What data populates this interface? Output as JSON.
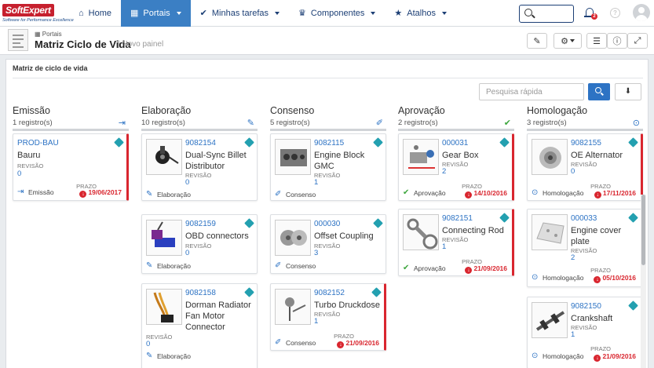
{
  "brand": {
    "logo_text": "SoftExpert",
    "tagline": "Software for Performance Excellence"
  },
  "nav": {
    "home": "Home",
    "portais": "Portais",
    "tarefas": "Minhas tarefas",
    "componentes": "Componentes",
    "atalhos": "Atalhos"
  },
  "notifications": {
    "badge": "2"
  },
  "header": {
    "breadcrumb": "Portais",
    "title": "Matriz Ciclo de Vida",
    "subtitle": "| Novo painel"
  },
  "panel": {
    "title": "Matriz de ciclo de vida",
    "quick_search_placeholder": "Pesquisa rápida"
  },
  "labels": {
    "revisao": "REVISÃO",
    "prazo": "PRAZO"
  },
  "columns": [
    {
      "name": "Emissão",
      "count": "1 registro(s)",
      "cards": [
        {
          "code": "PROD-BAU",
          "name": "Bauru",
          "rev": "0",
          "stage": "Emissão",
          "prazo": "19/06/2017"
        }
      ]
    },
    {
      "name": "Elaboração",
      "count": "10 registro(s)",
      "cards": [
        {
          "code": "9082154",
          "name": "Dual-Sync Billet Distributor",
          "rev": "0",
          "stage": "Elaboração"
        },
        {
          "code": "9082159",
          "name": "OBD connectors",
          "rev": "0",
          "stage": "Elaboração"
        },
        {
          "code": "9082158",
          "name": "Dorman Radiator Fan Motor Connector",
          "rev": "0",
          "stage": "Elaboração"
        }
      ]
    },
    {
      "name": "Consenso",
      "count": "5 registro(s)",
      "cards": [
        {
          "code": "9082115",
          "name": "Engine Block GMC",
          "rev": "1",
          "stage": "Consenso"
        },
        {
          "code": "000030",
          "name": "Offset Coupling",
          "rev": "3",
          "stage": "Consenso"
        },
        {
          "code": "9082152",
          "name": "Turbo Druckdose",
          "rev": "1",
          "stage": "Consenso",
          "prazo": "21/09/2016"
        }
      ]
    },
    {
      "name": "Aprovação",
      "count": "2 registro(s)",
      "cards": [
        {
          "code": "000031",
          "name": "Gear Box",
          "rev": "2",
          "stage": "Aprovação",
          "prazo": "14/10/2016"
        },
        {
          "code": "9082151",
          "name": "Connecting Rod",
          "rev": "1",
          "stage": "Aprovação",
          "prazo": "21/09/2016"
        }
      ]
    },
    {
      "name": "Homologação",
      "count": "3 registro(s)",
      "cards": [
        {
          "code": "9082155",
          "name": "OE Alternator",
          "rev": "0",
          "stage": "Homologação",
          "prazo": "17/11/2016"
        },
        {
          "code": "000033",
          "name": "Engine cover plate",
          "rev": "2",
          "stage": "Homologação",
          "prazo": "05/10/2016"
        },
        {
          "code": "9082150",
          "name": "Crankshaft",
          "rev": "1",
          "stage": "Homologação",
          "prazo": "21/09/2016"
        }
      ]
    }
  ],
  "colors": {
    "accent": "#3b7fc4",
    "link": "#2d73c4",
    "overdue": "#d9262f",
    "cube": "#23a0b0",
    "approved": "#3fa73f"
  }
}
